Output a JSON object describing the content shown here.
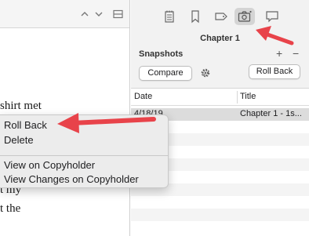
{
  "editor": {
    "text_lines": [
      "shirt met",
      "t my",
      "t the"
    ]
  },
  "inspector": {
    "tabs": [
      {
        "icon": "notes-icon"
      },
      {
        "icon": "bookmark-icon"
      },
      {
        "icon": "tag-icon"
      },
      {
        "icon": "camera-icon",
        "active": true
      },
      {
        "icon": "comment-icon"
      }
    ],
    "panel_title": "Chapter 1",
    "snapshots_label": "Snapshots",
    "add_label": "+",
    "remove_label": "−",
    "compare_label": "Compare",
    "rollback_label": "Roll Back",
    "table": {
      "columns": [
        "Date",
        "Title"
      ],
      "rows": [
        {
          "date": "4/18/19",
          "title": "Chapter 1 - 1s..."
        }
      ]
    }
  },
  "context_menu": {
    "items": [
      "Roll Back",
      "Delete",
      "View on Copyholder",
      "View Changes on Copyholder"
    ]
  },
  "colors": {
    "accent_arrow": "#e8434a",
    "selected_row": "#dcdcdc"
  }
}
